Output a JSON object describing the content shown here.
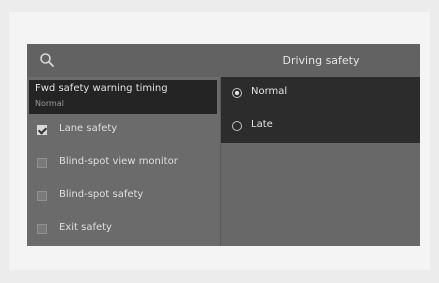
{
  "header": {
    "title": "Driving safety"
  },
  "selected_item": {
    "title": "Fwd safety warning timing",
    "value": "Normal"
  },
  "items": [
    {
      "label": "Lane safety",
      "checked": true
    },
    {
      "label": "Blind-spot view monitor",
      "checked": false
    },
    {
      "label": "Blind-spot safety",
      "checked": false
    },
    {
      "label": "Exit safety",
      "checked": false
    }
  ],
  "options": [
    {
      "label": "Normal",
      "selected": true
    },
    {
      "label": "Late",
      "selected": false
    }
  ]
}
